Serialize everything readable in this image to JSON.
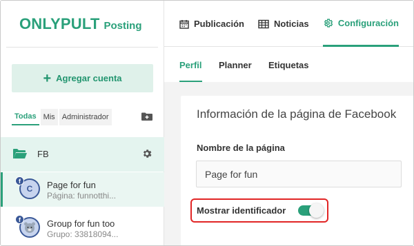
{
  "brand": {
    "name": "ONLYPULT",
    "sub": "Posting"
  },
  "sidebar": {
    "add_account_label": "Agregar cuenta",
    "filters": [
      {
        "label": "Todas",
        "active": true
      },
      {
        "label": "Mis",
        "active": false
      },
      {
        "label": "Administrador",
        "active": false
      }
    ],
    "group": {
      "name": "FB"
    },
    "accounts": [
      {
        "name": "Page for fun",
        "sub": "Página: funnotthi...",
        "avatar_letter": "C",
        "network": "f",
        "selected": true
      },
      {
        "name": "Group for fun too",
        "sub": "Grupo: 33818094...",
        "avatar_letter": "",
        "network": "f",
        "selected": false
      }
    ]
  },
  "topnav": {
    "tabs": [
      {
        "label": "Publicación",
        "icon": "calendar-icon",
        "active": false
      },
      {
        "label": "Noticias",
        "icon": "table-icon",
        "active": false
      },
      {
        "label": "Configuración",
        "icon": "gear-icon",
        "active": true
      }
    ]
  },
  "subtabs": [
    {
      "label": "Perfil",
      "active": true
    },
    {
      "label": "Planner",
      "active": false
    },
    {
      "label": "Etiquetas",
      "active": false
    }
  ],
  "card": {
    "title": "Información de la página de Facebook",
    "page_name_label": "Nombre de la página",
    "page_name_value": "Page for fun",
    "toggle_label": "Mostrar identificador",
    "toggle_on": true
  },
  "colors": {
    "accent": "#2aa07a",
    "highlight_border": "#e12424",
    "facebook": "#3b5998"
  }
}
